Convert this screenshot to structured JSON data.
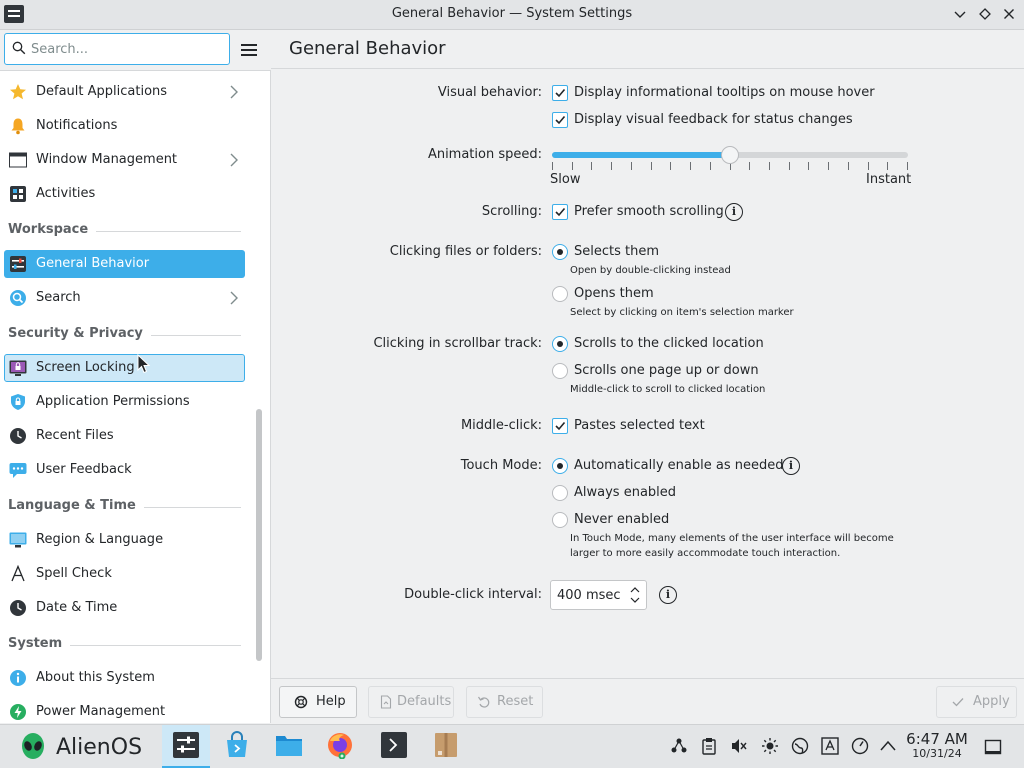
{
  "window": {
    "title": "General Behavior — System Settings",
    "minimize_glyph": "⌄",
    "maximize_glyph": "◇",
    "close_glyph": "✕"
  },
  "search": {
    "placeholder": "Search...",
    "value": ""
  },
  "page": {
    "title": "General Behavior"
  },
  "sidebar": {
    "items_top": [
      {
        "label": "Default Applications",
        "icon": "star-icon",
        "has_chevron": true
      },
      {
        "label": "Notifications",
        "icon": "bell-icon",
        "has_chevron": false
      },
      {
        "label": "Window Management",
        "icon": "window-icon",
        "has_chevron": true
      },
      {
        "label": "Activities",
        "icon": "activities-icon",
        "has_chevron": false
      }
    ],
    "sections": {
      "workspace": "Workspace",
      "security": "Security & Privacy",
      "language": "Language & Time",
      "system": "System"
    },
    "workspace_items": [
      {
        "label": "General Behavior",
        "icon": "settings-icon",
        "has_chevron": false,
        "state": "selected"
      },
      {
        "label": "Search",
        "icon": "search-globe-icon",
        "has_chevron": true
      }
    ],
    "security_items": [
      {
        "label": "Screen Locking",
        "icon": "screen-lock-icon",
        "state": "hover"
      },
      {
        "label": "Application Permissions",
        "icon": "shield-icon"
      },
      {
        "label": "Recent Files",
        "icon": "clock-icon"
      },
      {
        "label": "User Feedback",
        "icon": "feedback-icon"
      }
    ],
    "language_items": [
      {
        "label": "Region & Language",
        "icon": "region-icon"
      },
      {
        "label": "Spell Check",
        "icon": "spellcheck-icon"
      },
      {
        "label": "Date & Time",
        "icon": "clock-icon"
      }
    ],
    "system_items": [
      {
        "label": "About this System",
        "icon": "info-icon"
      },
      {
        "label": "Power Management",
        "icon": "power-icon"
      }
    ]
  },
  "settings": {
    "visual_behavior": {
      "label": "Visual behavior:",
      "tooltips": {
        "label": "Display informational tooltips on mouse hover",
        "checked": true
      },
      "feedback": {
        "label": "Display visual feedback for status changes",
        "checked": true
      }
    },
    "animation_speed": {
      "label": "Animation speed:",
      "min_label": "Slow",
      "max_label": "Instant",
      "value_fraction": 0.5
    },
    "scrolling": {
      "label": "Scrolling:",
      "smooth": {
        "label": "Prefer smooth scrolling",
        "checked": true
      }
    },
    "clicking_files": {
      "label": "Clicking files or folders:",
      "selects": {
        "label": "Selects them",
        "hint": "Open by double-clicking instead",
        "selected": true
      },
      "opens": {
        "label": "Opens them",
        "hint": "Select by clicking on item's selection marker",
        "selected": false
      }
    },
    "scrollbar_track": {
      "label": "Clicking in scrollbar track:",
      "scrolls_to": {
        "label": "Scrolls to the clicked location",
        "selected": true
      },
      "page_up_down": {
        "label": "Scrolls one page up or down",
        "hint": "Middle-click to scroll to clicked location",
        "selected": false
      }
    },
    "middle_click": {
      "label": "Middle-click:",
      "pastes": {
        "label": "Pastes selected text",
        "checked": true
      }
    },
    "touch_mode": {
      "label": "Touch Mode:",
      "auto": {
        "label": "Automatically enable as needed",
        "selected": true
      },
      "always": {
        "label": "Always enabled",
        "selected": false
      },
      "never": {
        "label": "Never enabled",
        "selected": false
      },
      "hint_line1": "In Touch Mode, many elements of the user interface will become",
      "hint_line2": "larger to more easily accommodate touch interaction."
    },
    "double_click": {
      "label": "Double-click interval:",
      "value": "400 msec"
    }
  },
  "buttons": {
    "help": "Help",
    "defaults": "Defaults",
    "reset": "Reset",
    "apply": "Apply"
  },
  "taskbar": {
    "launcher_label": "AlienOS",
    "time": "6:47 AM",
    "date": "10/31/24"
  },
  "colors": {
    "accent": "#3daee9",
    "selection_hover": "#cde8f7",
    "window_bg": "#eff0f1",
    "text": "#232629"
  }
}
